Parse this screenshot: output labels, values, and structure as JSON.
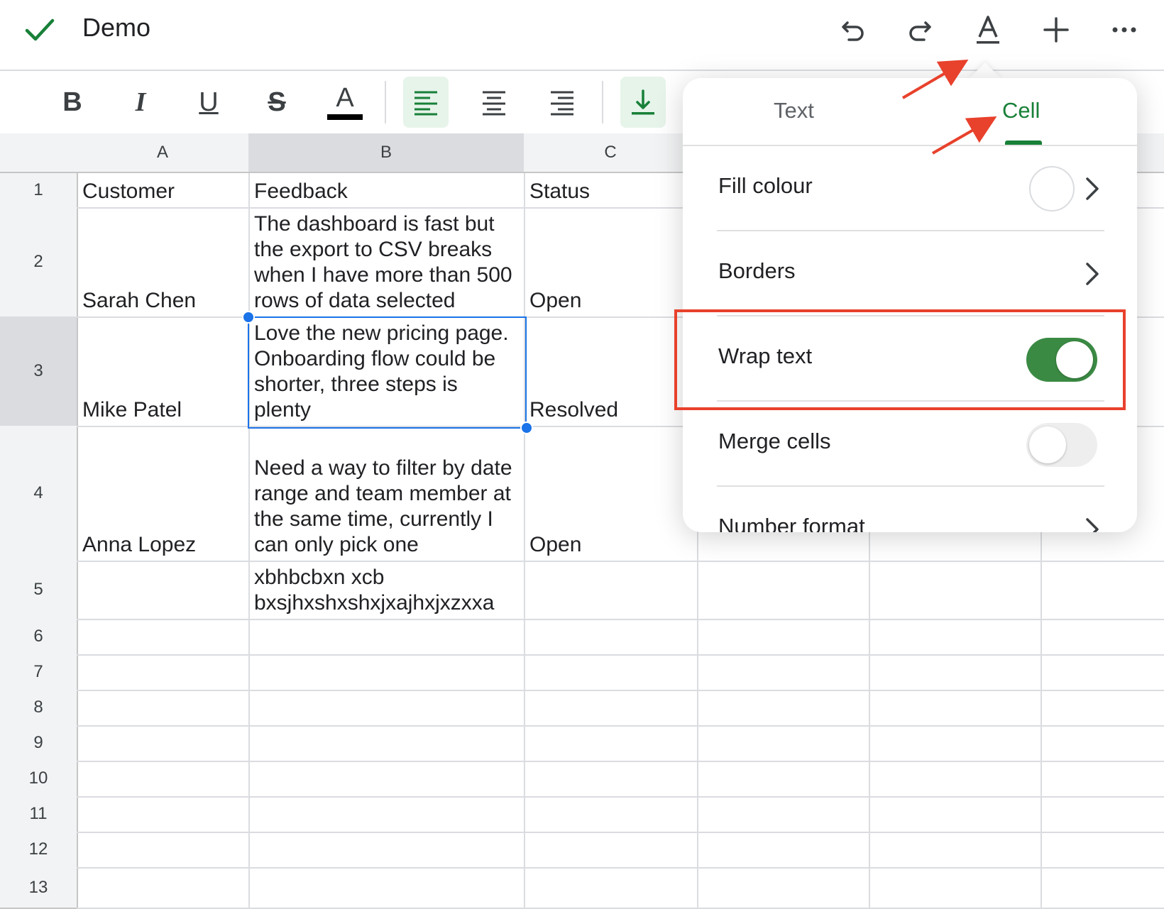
{
  "header": {
    "title": "Demo",
    "icons": [
      "check-icon",
      "undo-icon",
      "redo-icon",
      "text-format-icon",
      "insert-icon",
      "more-icon"
    ]
  },
  "toolbar": {
    "buttons": [
      {
        "name": "bold",
        "glyph": "B"
      },
      {
        "name": "italic",
        "glyph": "I"
      },
      {
        "name": "underline",
        "glyph": "U"
      },
      {
        "name": "strikethrough",
        "glyph": "S"
      },
      {
        "name": "text-color",
        "glyph": "A"
      },
      {
        "name": "align-left",
        "active": true
      },
      {
        "name": "align-center"
      },
      {
        "name": "align-right"
      },
      {
        "name": "vertical-align-bottom",
        "active": true
      }
    ]
  },
  "sheet": {
    "columns": [
      "A",
      "B",
      "C"
    ],
    "rows": [
      "1",
      "2",
      "3",
      "4",
      "5",
      "6",
      "7",
      "8",
      "9",
      "10",
      "11",
      "12",
      "13"
    ],
    "cells": {
      "A1": "Customer",
      "B1": "Feedback",
      "C1": "Status",
      "A2": "Sarah Chen",
      "B2": "The dashboard is fast but the export to CSV breaks when I have more than 500 rows of data selected",
      "C2": "Open",
      "A3": "Mike Patel",
      "B3": "Love the new pricing page. Onboarding flow could be shorter, three steps is plenty",
      "C3": "Resolved",
      "A4": "Anna Lopez",
      "B4": "Need a way to filter by date range and team member at the same time, currently I can only pick one",
      "C4": "Open",
      "B5": "xbhbcbxn xcb bxsjhxshxshxjxajhxjxzxxa"
    },
    "selected_cell": "B3"
  },
  "popover": {
    "tabs": [
      {
        "label": "Text"
      },
      {
        "label": "Cell",
        "active": true
      }
    ],
    "items": [
      {
        "label": "Fill colour",
        "fill_color": "#ffffff"
      },
      {
        "label": "Borders"
      },
      {
        "label": "Wrap text",
        "enabled": true
      },
      {
        "label": "Merge cells",
        "enabled": false
      },
      {
        "label": "Number format"
      }
    ]
  },
  "colors": {
    "accent_green": "#188038",
    "toggle_on": "#3b8a44",
    "selection_blue": "#1a73e8",
    "annotation_red": "#e8412c"
  }
}
